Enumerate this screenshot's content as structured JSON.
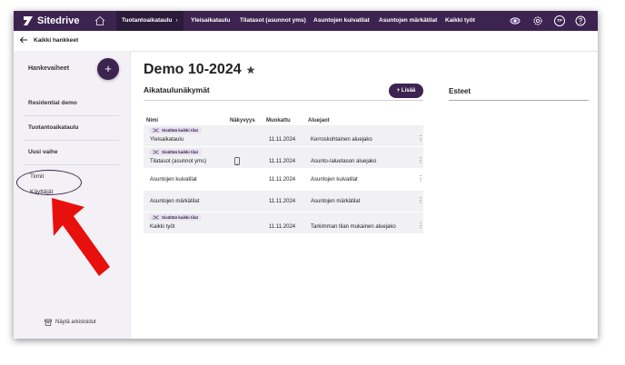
{
  "app": {
    "name": "Sitedrive"
  },
  "topnav": {
    "tabs": [
      {
        "label": "Tuotantoaikataulu",
        "active": true
      },
      {
        "label": "Yleisaikataulu",
        "active": false
      },
      {
        "label": "Tilatasot (asunnot yms)",
        "active": false
      },
      {
        "label": "Asuntojen kuivatilat",
        "active": false
      },
      {
        "label": "Asuntojen märkätilat",
        "active": false
      },
      {
        "label": "Kaikki työt",
        "active": false
      }
    ],
    "avatar_initials": "TP"
  },
  "breadcrumb": {
    "back_label": "Kaikki hankkeet"
  },
  "sidebar": {
    "title": "Hankevaiheet",
    "items": [
      {
        "label": "Residential demo"
      },
      {
        "label": "Tuotantoaikataulu"
      },
      {
        "label": "Uusi vaihe"
      }
    ],
    "sub_items": [
      {
        "label": "Tiimit"
      },
      {
        "label": "Käyttäjät"
      }
    ],
    "archive_label": "Näytä arkistoidut"
  },
  "main": {
    "title": "Demo 10-2024",
    "schedule_section_title": "Aikataulunäkymät",
    "add_label": "Lisää",
    "obstacles_title": "Esteet",
    "table": {
      "headers": [
        "Nimi",
        "Näkyvyys",
        "Muokattu",
        "Aluejaot"
      ],
      "badge_text": "Sisältää kaikki tilat",
      "rows": [
        {
          "name": "Yleisaikataulu",
          "modified": "11.11.2024",
          "division": "Kerroskohtainen aluejako",
          "badge": true,
          "mobile": false
        },
        {
          "name": "Tilatasot (asunnot yms)",
          "modified": "11.11.2024",
          "division": "Asunto-/aluetason aluejako",
          "badge": true,
          "mobile": true
        },
        {
          "name": "Asuntojen kuivatilat",
          "modified": "11.11.2024",
          "division": "Asuntojen kuivatilat",
          "badge": false,
          "mobile": false
        },
        {
          "name": "Asuntojen märkätilat",
          "modified": "11.11.2024",
          "division": "Asuntojen märkätilat",
          "badge": false,
          "mobile": false
        },
        {
          "name": "Kaikki työt",
          "modified": "11.11.2024",
          "division": "Tarkimman tilan mukainen aluejako",
          "badge": true,
          "mobile": false
        }
      ]
    }
  },
  "colors": {
    "brand": "#3d2450",
    "annotation_arrow": "#e8100c"
  }
}
